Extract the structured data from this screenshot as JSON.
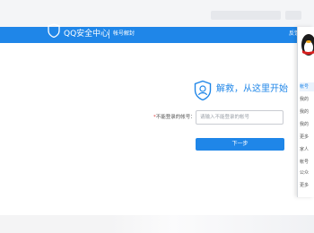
{
  "header": {
    "brand": "QQ安全中心",
    "subtitle": "帐号解封",
    "right_text": "反馈"
  },
  "main": {
    "title": "解救，从这里开始",
    "field": {
      "label": "不能登录的帐号：",
      "required_mark": "*",
      "placeholder": "请输入不能登录的帐号",
      "value": ""
    },
    "next_label": "下一步"
  },
  "side_panel": {
    "items": [
      "帐号",
      "我的",
      "我的",
      "我的",
      "更多",
      "家人",
      "帐号",
      "公众",
      "更多"
    ]
  },
  "colors": {
    "accent": "#1f86e8",
    "required": "#e03b3b"
  },
  "icons": [
    "shield-icon",
    "qq-penguin-icon"
  ]
}
